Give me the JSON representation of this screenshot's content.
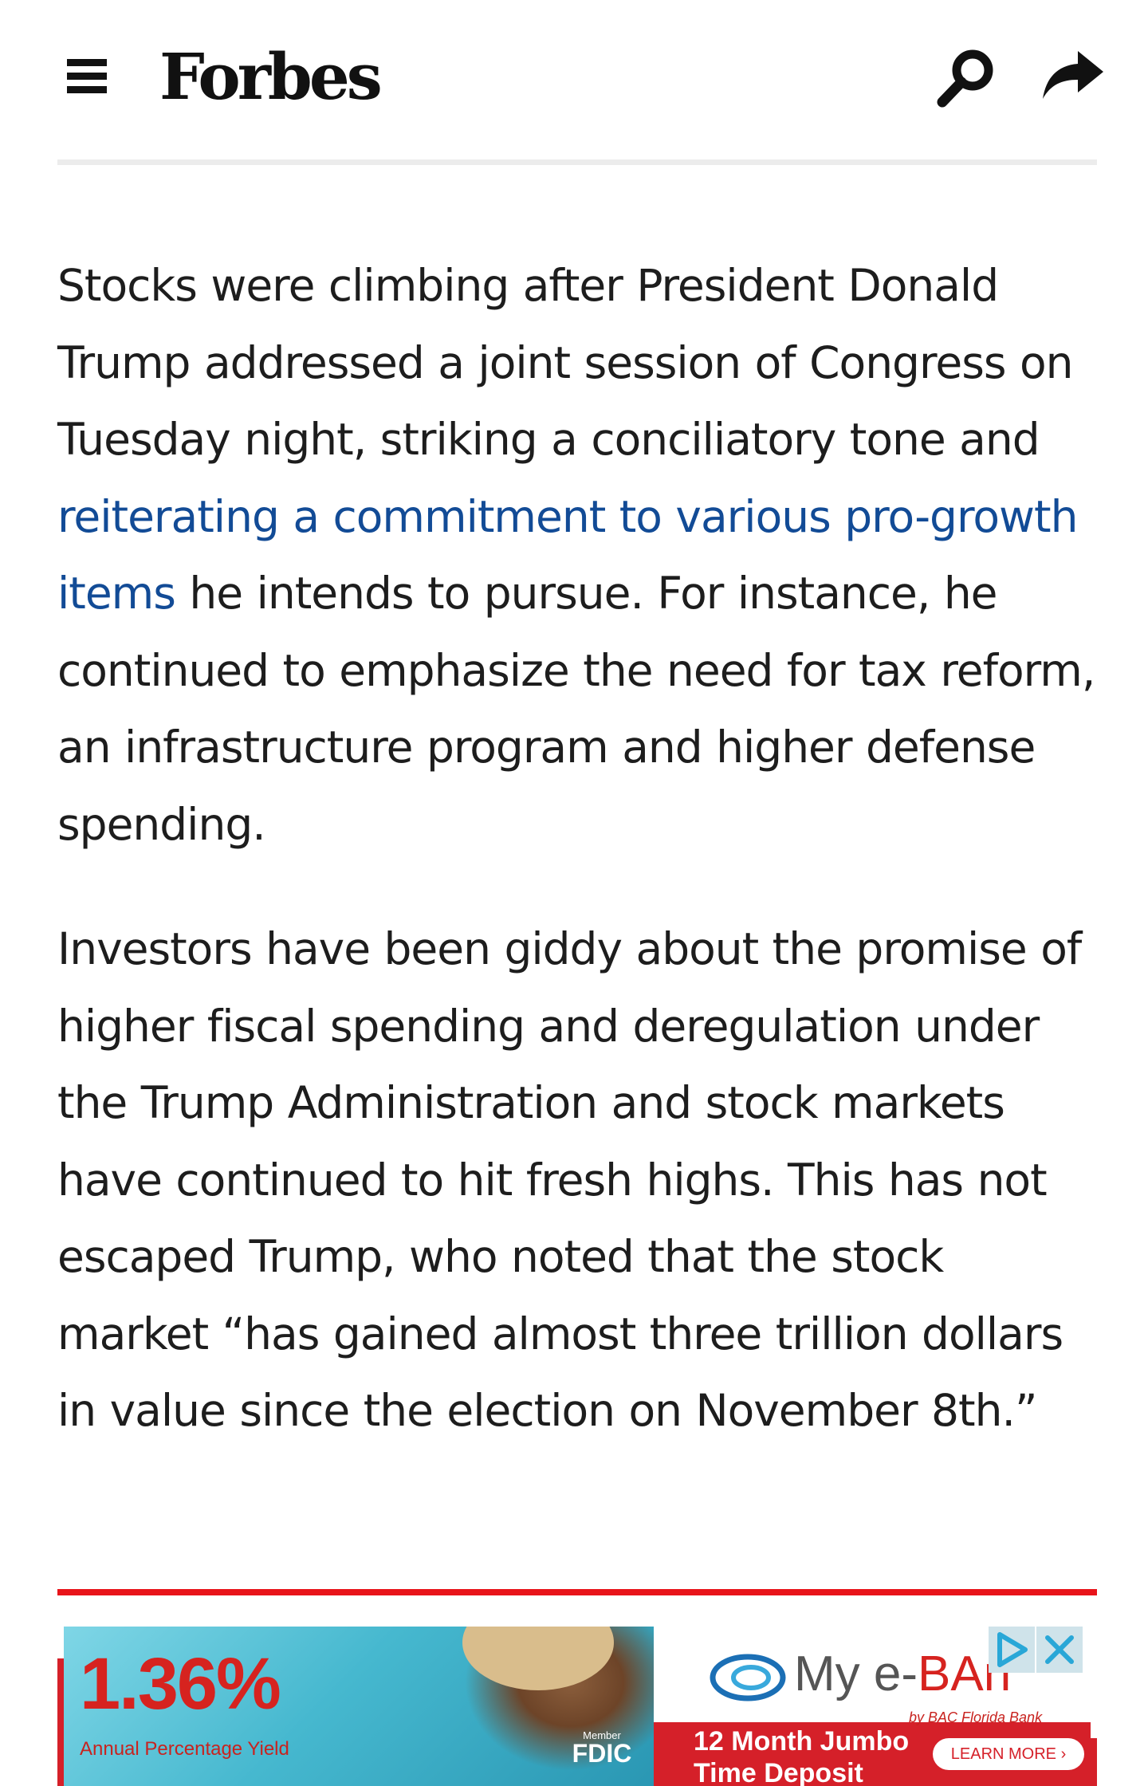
{
  "header": {
    "logo": "Forbes"
  },
  "article": {
    "p1_before": "Stocks were climbing after President Donald Trump addressed a joint session of Congress on Tuesday night, striking a conciliatory tone and ",
    "p1_link": "reiterating a commitment to various pro-growth items",
    "p1_after": " he intends to pursue. For instance, he continued to emphasize the need for tax reform, an infrastructure program and higher defense spending.",
    "p2": "Investors have been giddy about the promise of higher fiscal spending and deregulation under the Trump Administration and stock markets have continued to hit fresh highs. This has not escaped Trump, who noted that the stock market “has gained almost three trillion dollars in value since the election on November 8th.”"
  },
  "ad": {
    "rate": "1.36%",
    "rate_label": "Annual Percentage Yield",
    "fdic_member": "Member",
    "fdic": "FDIC",
    "brand_my": "My e-",
    "brand_bank": "BAn",
    "brand_sub": "by BAC Florida Bank",
    "offer_line1": "12 Month Jumbo",
    "offer_line2": "Time Deposit",
    "learn_more": "LEARN MORE ›"
  },
  "colors": {
    "link": "#124b96",
    "accent_red": "#e8141a",
    "text": "#1d1d1d"
  },
  "icons": {
    "menu": "hamburger-menu-icon",
    "search": "search-icon",
    "share": "share-icon",
    "ad_choices": "ad-choices-icon",
    "ad_close": "close-icon"
  }
}
